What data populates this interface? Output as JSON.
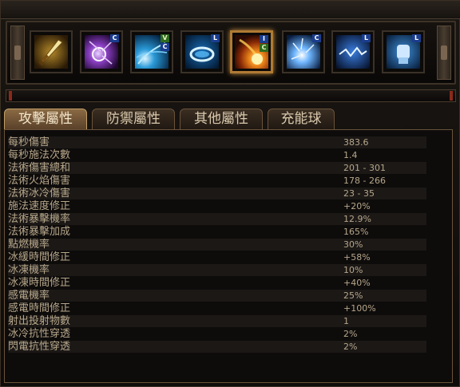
{
  "skills": [
    {
      "icon": "sword-icon",
      "badges": []
    },
    {
      "icon": "arcane-sphere-icon",
      "badges": [
        "C"
      ]
    },
    {
      "icon": "frost-nova-icon",
      "badges": [
        "V",
        "C"
      ]
    },
    {
      "icon": "ice-ring-icon",
      "badges": [
        "L"
      ]
    },
    {
      "icon": "fireball-icon",
      "badges": [
        "I",
        "C"
      ],
      "active": true
    },
    {
      "icon": "lightning-burst-icon",
      "badges": [
        "C"
      ]
    },
    {
      "icon": "chain-lightning-icon",
      "badges": [
        "L"
      ]
    },
    {
      "icon": "shock-fist-icon",
      "badges": [
        "L"
      ]
    }
  ],
  "tabs": [
    {
      "label": "攻擊屬性",
      "active": true
    },
    {
      "label": "防禦屬性",
      "active": false
    },
    {
      "label": "其他屬性",
      "active": false
    },
    {
      "label": "充能球",
      "active": false
    }
  ],
  "stats": [
    {
      "label": "每秒傷害",
      "value": "383.6"
    },
    {
      "label": "每秒施法次數",
      "value": "1.4"
    },
    {
      "label": "法術傷害總和",
      "value": "201 - 301"
    },
    {
      "label": "法術火焰傷害",
      "value": "178 - 266"
    },
    {
      "label": "法術冰冷傷害",
      "value": "23 - 35"
    },
    {
      "label": "施法速度修正",
      "value": "+20%"
    },
    {
      "label": "法術暴擊機率",
      "value": "12.9%"
    },
    {
      "label": "法術暴擊加成",
      "value": "165%"
    },
    {
      "label": "點燃機率",
      "value": "30%"
    },
    {
      "label": "冰緩時間修正",
      "value": "+58%"
    },
    {
      "label": "冰凍機率",
      "value": "10%"
    },
    {
      "label": "冰凍時間修正",
      "value": "+40%"
    },
    {
      "label": "感電機率",
      "value": "25%"
    },
    {
      "label": "感電時間修正",
      "value": "+100%"
    },
    {
      "label": "射出投射物數",
      "value": "1"
    },
    {
      "label": "冰冷抗性穿透",
      "value": "2%"
    },
    {
      "label": "閃電抗性穿透",
      "value": "2%"
    }
  ],
  "colors": {
    "accent": "#b07a34",
    "text": "#b7a78b",
    "tab_active": "#8a6a44"
  }
}
